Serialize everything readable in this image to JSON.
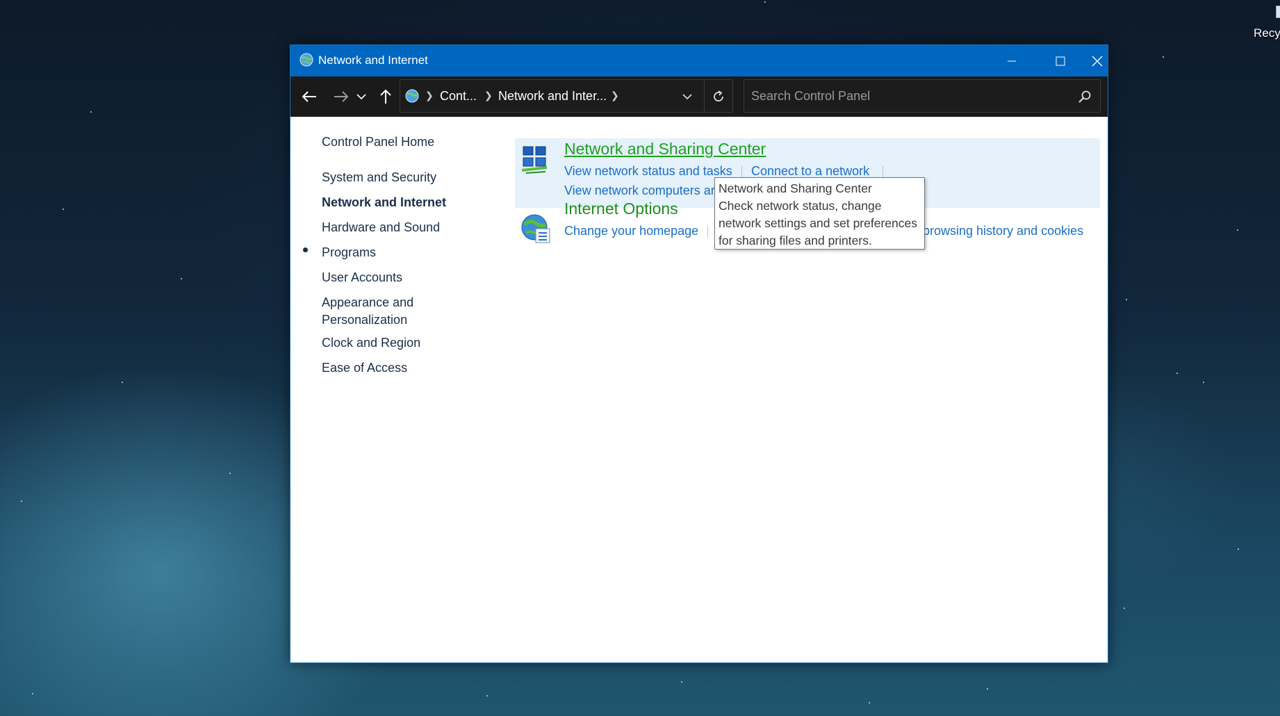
{
  "desktop": {
    "recycle_bin_label": "Recyc"
  },
  "window": {
    "title": "Network and Internet",
    "title_icon": "globe-network-icon"
  },
  "toolbar": {
    "breadcrumbs": [
      "Cont...",
      "Network and Inter..."
    ],
    "search_placeholder": "Search Control Panel"
  },
  "sidebar": {
    "home": "Control Panel Home",
    "items": [
      {
        "label": "System and Security",
        "active": false
      },
      {
        "label": "Network and Internet",
        "active": true
      },
      {
        "label": "Hardware and Sound",
        "active": false
      },
      {
        "label": "Programs",
        "active": false
      },
      {
        "label": "User Accounts",
        "active": false
      },
      {
        "label": "Appearance and",
        "label2": "Personalization",
        "active": false
      },
      {
        "label": "Clock and Region",
        "active": false
      },
      {
        "label": "Ease of Access",
        "active": false
      }
    ]
  },
  "categories": [
    {
      "title": "Network and Sharing Center",
      "icon": "network-sharing-icon",
      "links": [
        "View network status and tasks",
        "Connect to a network",
        "View network computers ar"
      ]
    },
    {
      "title": "Internet Options",
      "icon": "internet-options-icon",
      "links": [
        "Change your homepage",
        "browsing history and cookies"
      ]
    }
  ],
  "tooltip": {
    "lines": [
      "Network and Sharing Center",
      "Check network status, change",
      "network settings and set preferences",
      "for sharing files and printers."
    ]
  },
  "colors": {
    "titlebar": "#0067c0",
    "link": "#1a6fc4",
    "category_title": "#1e8d1e",
    "hover_bg": "#e5f1fb"
  }
}
